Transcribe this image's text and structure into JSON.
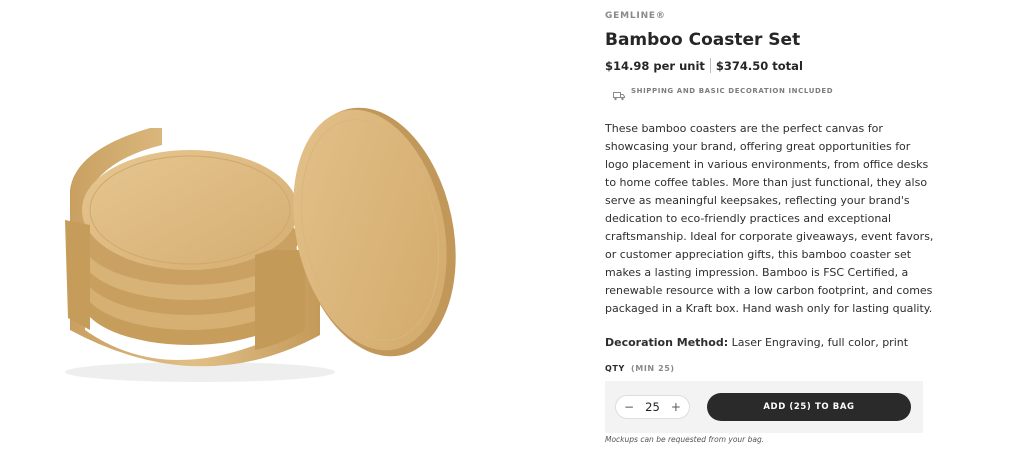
{
  "product": {
    "brand": "GEMLINE®",
    "title": "Bamboo Coaster Set",
    "unit_price": "$14.98 per unit",
    "total_price": "$374.50 total",
    "shipping_note": "SHIPPING AND BASIC DECORATION INCLUDED",
    "description": "These bamboo coasters are the perfect canvas for showcasing your brand, offering great opportunities for logo placement in various environments, from office desks to home coffee tables. More than just functional, they also serve as meaningful keepsakes, reflecting your brand's dedication to eco-friendly practices and exceptional craftsmanship. Ideal for corporate giveaways, event favors, or customer appreciation gifts, this bamboo coaster set makes a lasting impression. Bamboo is FSC Certified, a renewable resource with a low carbon footprint, and comes packaged in a Kraft box. Hand wash only for lasting quality.",
    "decoration_label": "Decoration Method:",
    "decoration_value": "Laser Engraving, full color, print"
  },
  "order": {
    "qty_label": "QTY",
    "qty_min": "(MIN 25)",
    "decrement": "−",
    "quantity": "25",
    "increment": "+",
    "add_button": "ADD (25) TO BAG",
    "mockup_note": "Mockups can be requested from your bag."
  },
  "icons": {
    "shipping": "truck-icon",
    "product_image": "bamboo-coaster-set-image"
  },
  "colors": {
    "bamboo": "#d9b57c",
    "bamboo_dark": "#b8904f",
    "button": "#2a2a2a",
    "order_box": "#f3f3f3"
  }
}
